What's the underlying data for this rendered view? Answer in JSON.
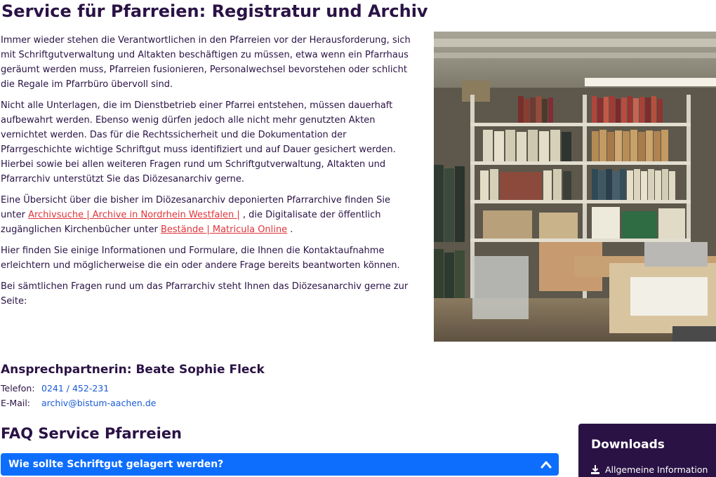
{
  "page": {
    "title": "Service für Pfarreien: Registratur und Archiv"
  },
  "intro": {
    "p1": "Immer wieder stehen die Verantwortlichen in den Pfarreien vor der Herausforderung, sich mit Schriftgutverwaltung und Altakten beschäftigen zu müssen, etwa wenn ein Pfarrhaus geräumt werden muss, Pfarreien fusionieren, Personalwechsel bevorstehen oder schlicht die Regale im Pfarrbüro übervoll sind.",
    "p2": "Nicht alle Unterlagen, die im Dienstbetrieb einer Pfarrei entstehen, müssen dauerhaft aufbewahrt werden. Ebenso wenig dürfen jedoch alle nicht mehr genutzten Akten vernichtet werden. Das für die Rechtssicherheit und die Dokumentation der Pfarrgeschichte wichtige Schriftgut muss identifiziert und auf Dauer gesichert werden. Hierbei sowie bei allen weiteren Fragen rund um Schriftgutverwaltung, Altakten und Pfarrarchiv unterstützt Sie das Diözesanarchiv gerne.",
    "p3_before": "Eine Übersicht über die bisher im Diözesanarchiv deponierten Pfarrarchive finden Sie unter ",
    "p3_link1": "Archivsuche | Archive in Nordrhein Westfalen |",
    "p3_middle": " , die Digitalisate der öffentlich zugänglichen Kirchenbücher unter ",
    "p3_link2": "Bestände | Matricula Online",
    "p3_after": " .",
    "p4": "Hier finden Sie einige Informationen und Formulare, die Ihnen die Kontaktaufnahme erleichtern und möglicherweise die ein oder andere Frage bereits beantworten können.",
    "p5": "Bei sämtlichen Fragen rund um das Pfarrarchiv steht Ihnen das Diözesanarchiv gerne zur Seite:"
  },
  "contact": {
    "title": "Ansprechpartnerin: Beate Sophie Fleck",
    "phone_label": "Telefon:",
    "phone": "0241 / 452-231",
    "email_label": "E-Mail:",
    "email": "archiv@bistum-aachen.de"
  },
  "faq": {
    "title": "FAQ Service Pfarreien",
    "items": [
      {
        "question": "Wie sollte Schriftgut gelagert werden?",
        "expanded": true
      }
    ]
  },
  "downloads": {
    "title": "Downloads",
    "items": [
      {
        "label": "Allgemeine Information",
        "icon": "download-icon"
      }
    ]
  },
  "colors": {
    "text": "#2a1245",
    "link_red": "#e0343a",
    "link_blue": "#1a5bd6",
    "accordion": "#0d6efd",
    "sidebar": "#2a1245"
  }
}
